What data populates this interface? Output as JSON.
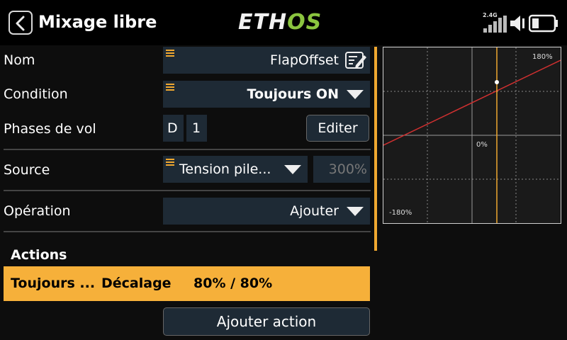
{
  "header": {
    "title": "Mixage libre",
    "logo_part1": "ETH",
    "logo_part2": "OS",
    "freq_label": "2.4G"
  },
  "form": {
    "name_label": "Nom",
    "name_value": "FlapOffset",
    "condition_label": "Condition",
    "condition_value": "Toujours ON",
    "phases_label": "Phases de vol",
    "phases": [
      "D",
      "1"
    ],
    "edit_button": "Editer",
    "source_label": "Source",
    "source_value": "Tension pile...",
    "source_percent": "300%",
    "operation_label": "Opération",
    "operation_value": "Ajouter"
  },
  "actions": {
    "title": "Actions",
    "row": {
      "condition": "Toujours ...",
      "type": "Décalage",
      "value": "80% / 80%"
    },
    "add_button": "Ajouter action"
  },
  "graph": {
    "label_top": "180%",
    "label_center": "0%",
    "label_bottom": "-180%",
    "curve_color": "#d03030",
    "cursor_color": "#f0a830"
  }
}
